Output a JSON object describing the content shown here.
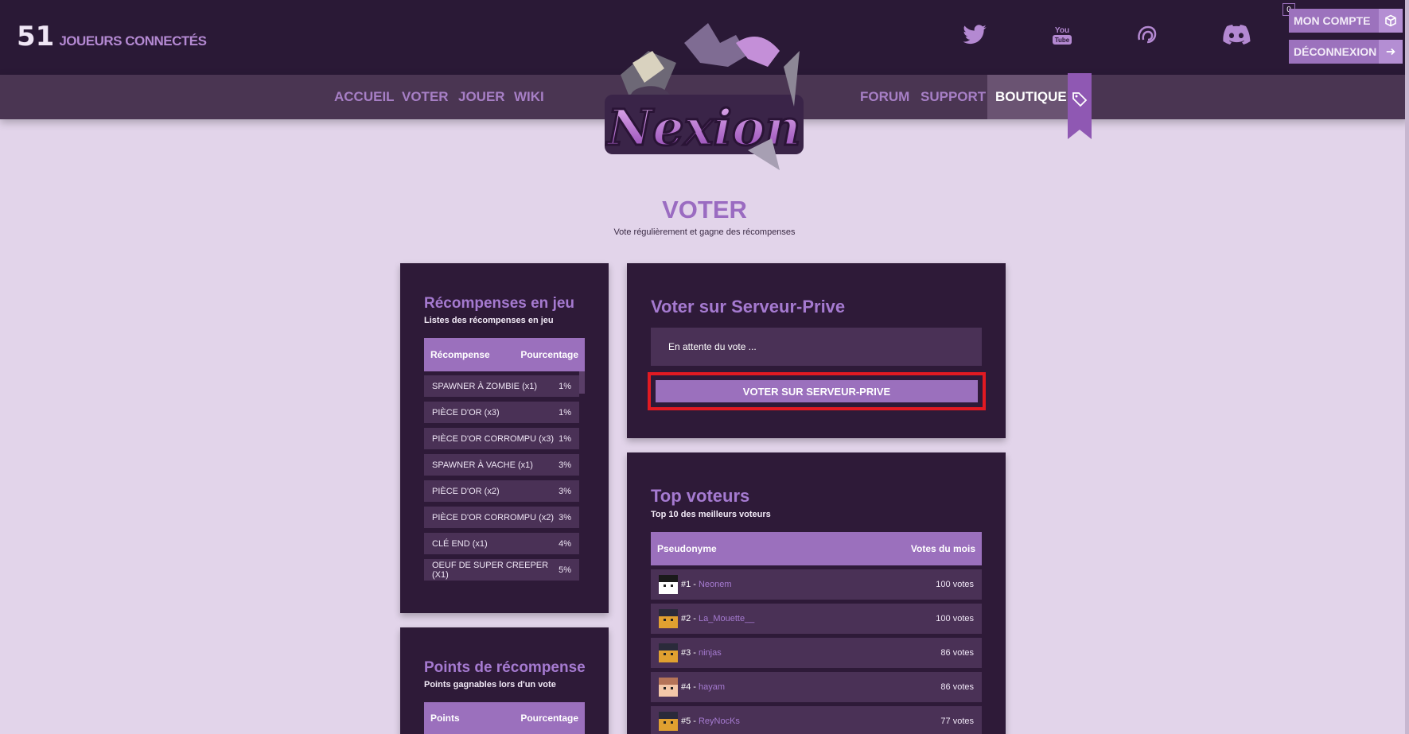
{
  "header": {
    "players_count": "51",
    "players_label": "JOUEURS CONNECTÉS",
    "account_label": "MON COMPTE",
    "logout_label": "DÉCONNEXION",
    "cart_count": "0"
  },
  "nav": {
    "left": [
      "ACCUEIL",
      "VOTER",
      "JOUER",
      "WIKI"
    ],
    "right": [
      "FORUM",
      "SUPPORT",
      "BOUTIQUE"
    ]
  },
  "logo_text": "Nexion",
  "page": {
    "title": "VOTER",
    "subtitle": "Vote régulièrement et gagne des récompenses"
  },
  "rewards": {
    "title": "Récompenses en jeu",
    "subtitle": "Listes des récompenses en jeu",
    "col1": "Récompense",
    "col2": "Pourcentage",
    "rows": [
      {
        "name": "SPAWNER À ZOMBIE (x1)",
        "pct": "1%"
      },
      {
        "name": "PIÈCE D'OR (x3)",
        "pct": "1%"
      },
      {
        "name": "PIÈCE D'OR CORROMPU (x3)",
        "pct": "1%"
      },
      {
        "name": "SPAWNER À VACHE (x1)",
        "pct": "3%"
      },
      {
        "name": "PIÈCE D'OR (x2)",
        "pct": "3%"
      },
      {
        "name": "PIÈCE D'OR CORROMPU (x2)",
        "pct": "3%"
      },
      {
        "name": "CLÉ END (x1)",
        "pct": "4%"
      },
      {
        "name": "OEUF DE SUPER CREEPER (X1)",
        "pct": "5%"
      }
    ]
  },
  "points": {
    "title": "Points de récompense",
    "subtitle": "Points gagnables lors d'un vote",
    "col1": "Points",
    "col2": "Pourcentage"
  },
  "vote": {
    "title": "Voter sur Serveur-Prive",
    "status": "En attente du vote ...",
    "button": "VOTER SUR SERVEUR-PRIVE"
  },
  "top": {
    "title": "Top voteurs",
    "subtitle": "Top 10 des meilleurs voteurs",
    "col1": "Pseudonyme",
    "col2": "Votes du mois",
    "rows": [
      {
        "rank": "#1 -",
        "name": "Neonem",
        "votes": "100 votes"
      },
      {
        "rank": "#2 -",
        "name": "La_Mouette__",
        "votes": "100 votes"
      },
      {
        "rank": "#3 -",
        "name": "ninjas",
        "votes": "86 votes"
      },
      {
        "rank": "#4 -",
        "name": "hayam",
        "votes": "86 votes"
      },
      {
        "rank": "#5 -",
        "name": "ReyNocKs",
        "votes": "77 votes"
      }
    ]
  },
  "colors": {
    "dark": "#2a1936",
    "panel": "#2e1a38",
    "accent": "#9b70bd",
    "highlight": "#e21a22",
    "background": "#e2d4ea"
  }
}
